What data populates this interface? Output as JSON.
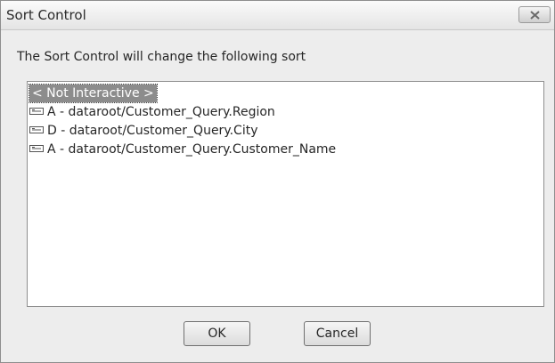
{
  "window": {
    "title": "Sort Control",
    "close_icon": "close-icon"
  },
  "message": "The Sort Control will change the following sort",
  "sort_list": {
    "selected_item": "< Not Interactive >",
    "items": [
      {
        "label": "A - dataroot/Customer_Query.Region",
        "icon": "sort-field-icon"
      },
      {
        "label": "D - dataroot/Customer_Query.City",
        "icon": "sort-field-icon"
      },
      {
        "label": "A - dataroot/Customer_Query.Customer_Name",
        "icon": "sort-field-icon"
      }
    ]
  },
  "buttons": {
    "ok_label": "OK",
    "cancel_label": "Cancel"
  }
}
